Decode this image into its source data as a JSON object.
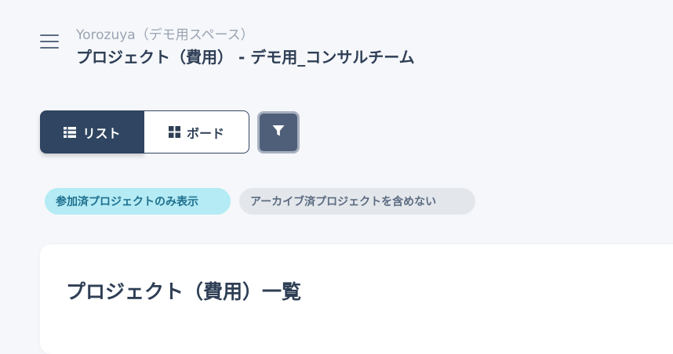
{
  "header": {
    "subtitle": "Yorozuya（デモ用スペース）",
    "title": "プロジェクト（費用） - デモ用_コンサルチーム",
    "menu_icon": "hamburger-menu-icon"
  },
  "view_toggle": {
    "list_label": "リスト",
    "list_icon": "list-icon",
    "board_label": "ボード",
    "board_icon": "grid-icon",
    "selected": "list"
  },
  "filter_button": {
    "icon": "filter-icon"
  },
  "filter_chips": [
    {
      "label": "参加済プロジェクトのみ表示",
      "active": true
    },
    {
      "label": "アーカイブ済プロジェクトを含めない",
      "active": false
    }
  ],
  "main": {
    "card_title": "プロジェクト（費用）一覧"
  },
  "colors": {
    "primary": "#2f4561",
    "background": "#f5f7fa",
    "active_chip_bg": "#b4ebf4",
    "inactive_chip_bg": "#e3e7ec"
  }
}
